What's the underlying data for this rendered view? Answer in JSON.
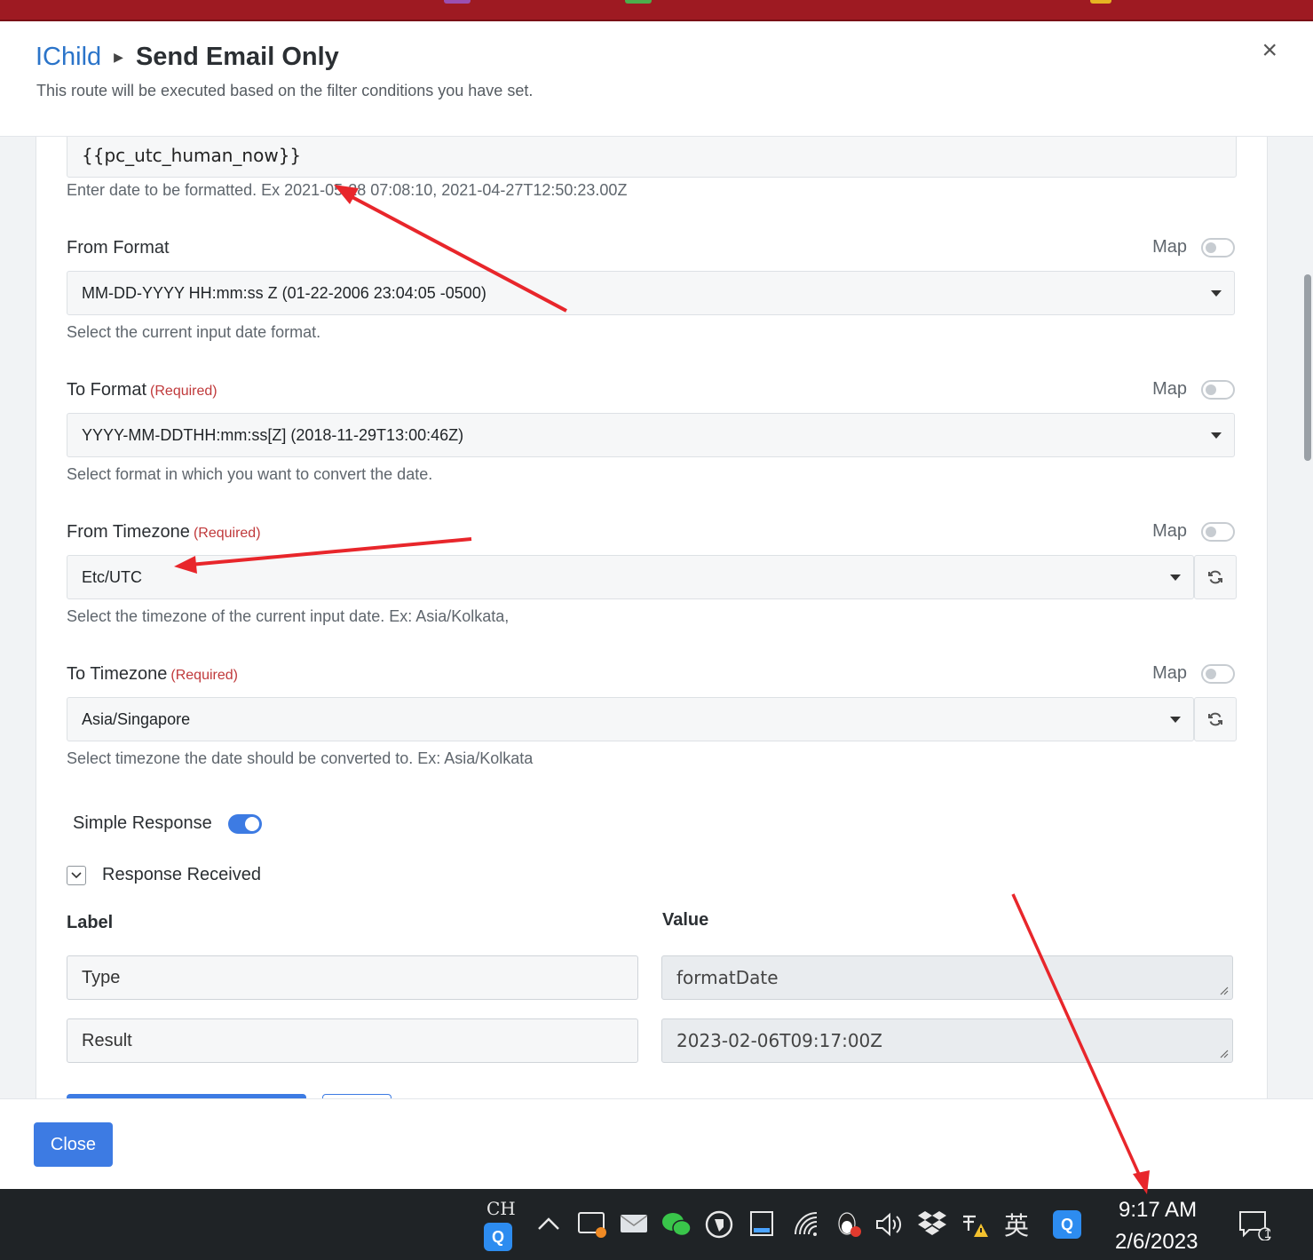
{
  "header": {
    "breadcrumb_parent": "IChild",
    "title": "Send Email Only",
    "subtitle": "This route will be executed based on the filter conditions you have set.",
    "close_glyph": "×"
  },
  "date_field": {
    "value": "{{pc_utc_human_now}}",
    "help": "Enter date to be formatted. Ex 2021-05-28 07:08:10, 2021-04-27T12:50:23.00Z"
  },
  "map_label": "Map",
  "required_label": "(Required)",
  "from_format": {
    "label": "From Format",
    "value": "MM-DD-YYYY HH:mm:ss Z (01-22-2006 23:04:05 -0500)",
    "help": "Select the current input date format."
  },
  "to_format": {
    "label": "To Format",
    "value": "YYYY-MM-DDTHH:mm:ss[Z] (2018-11-29T13:00:46Z)",
    "help": "Select format in which you want to convert the date."
  },
  "from_timezone": {
    "label": "From Timezone",
    "value": "Etc/UTC",
    "help": "Select the timezone of the current input date. Ex: Asia/Kolkata,"
  },
  "to_timezone": {
    "label": "To Timezone",
    "value": "Asia/Singapore",
    "help": "Select timezone the date should be converted to. Ex: Asia/Kolkata"
  },
  "simple_response": {
    "label": "Simple Response",
    "enabled": true
  },
  "response_received": {
    "label": "Response Received",
    "col_label": "Label",
    "col_value": "Value",
    "rows": [
      {
        "label": "Type",
        "value": "formatDate"
      },
      {
        "label": "Result",
        "value": "2023-02-06T09:17:00Z"
      }
    ]
  },
  "footer": {
    "close_label": "Close"
  },
  "taskbar": {
    "input_lang": "CH",
    "ime": "英",
    "time": "9:17 AM",
    "date": "2/6/2023",
    "notification_count": "1",
    "icons": [
      "qq-app-icon",
      "show-hidden-icons-chevron",
      "screen-share-icon",
      "mail-icon",
      "wechat-icon",
      "chat-bubble-icon",
      "keyboard-layout-icon",
      "wifi-icon",
      "qq-penguin-icon",
      "volume-icon",
      "dropbox-icon",
      "power-warning-icon",
      "qq-tray-icon",
      "notification-center-icon"
    ]
  },
  "colors": {
    "accent": "#3d7be3",
    "required": "#c0393b",
    "link": "#2b74c9",
    "annotation_arrow": "#e8262b"
  }
}
